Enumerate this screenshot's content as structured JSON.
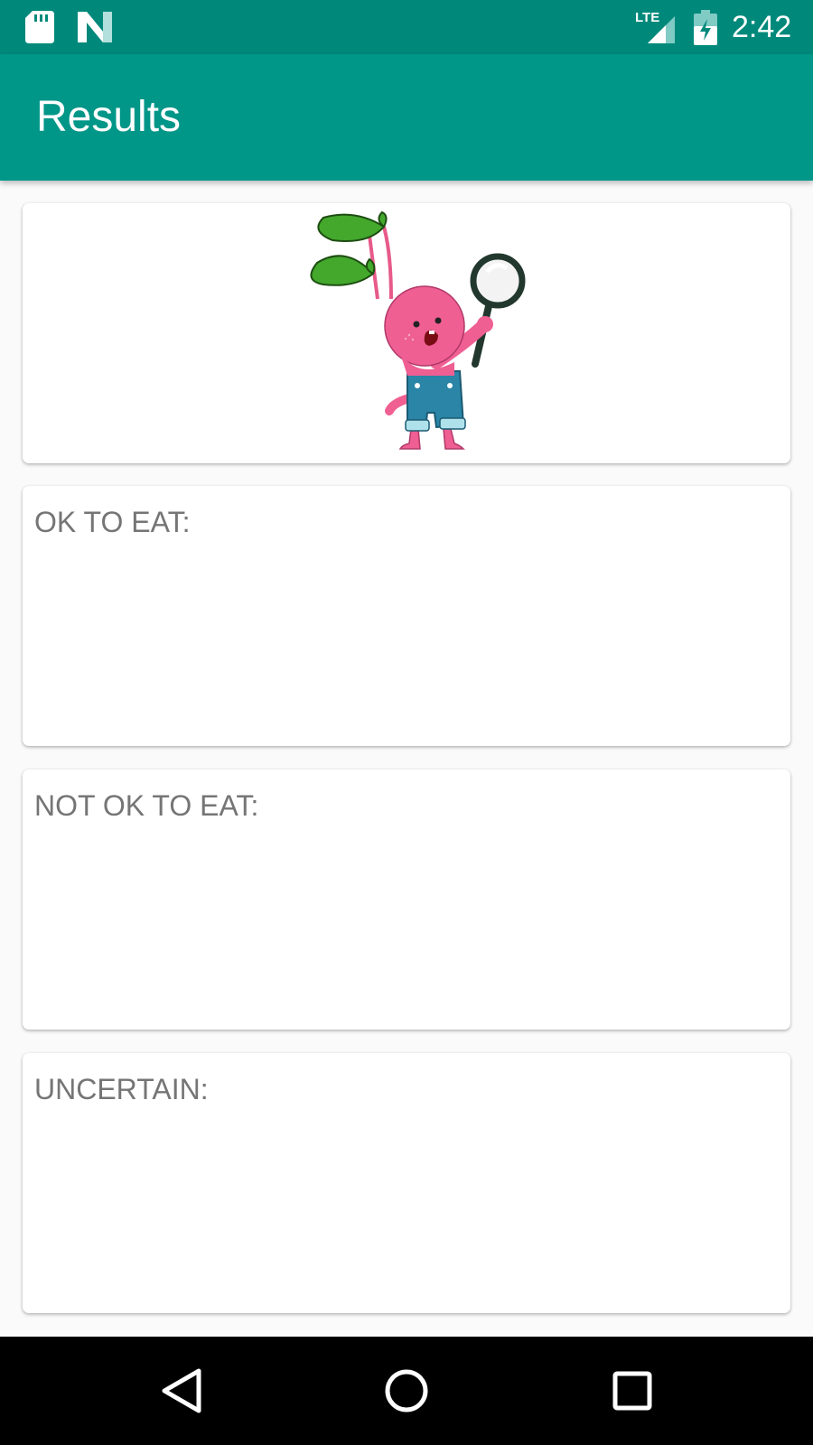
{
  "status_bar": {
    "time": "2:42",
    "network": "LTE",
    "icons": [
      "sd-card-icon",
      "n-logo-icon",
      "lte-signal-icon",
      "battery-charging-icon"
    ]
  },
  "app_bar": {
    "title": "Results",
    "color": "#009688"
  },
  "results": {
    "ok_label": "OK TO EAT:",
    "not_ok_label": "NOT OK TO EAT:",
    "uncertain_label": "UNCERTAIN:"
  },
  "image_card": {
    "icon": "radish-mascot-with-magnifier"
  },
  "nav_bar": {
    "icons": [
      "back-icon",
      "home-icon",
      "recents-icon"
    ]
  }
}
